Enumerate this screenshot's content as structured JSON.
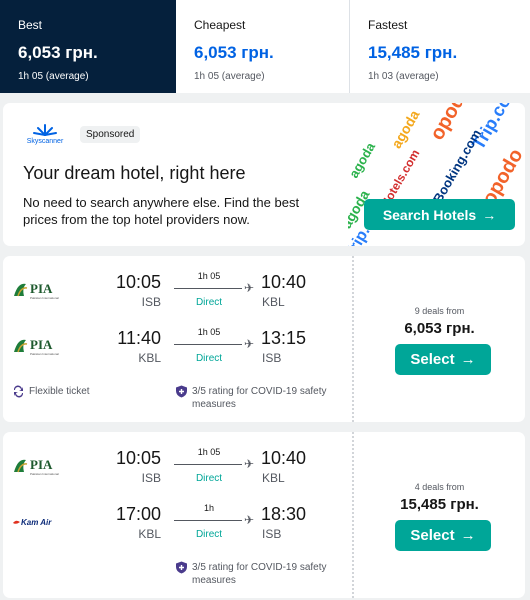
{
  "sort_tabs": [
    {
      "label": "Best",
      "price": "6,053 грн.",
      "duration": "1h 05 (average)"
    },
    {
      "label": "Cheapest",
      "price": "6,053 грн.",
      "duration": "1h 05 (average)"
    },
    {
      "label": "Fastest",
      "price": "15,485 грн.",
      "duration": "1h 03 (average)"
    }
  ],
  "ad": {
    "brand": "Skyscanner",
    "sponsored": "Sponsored",
    "title": "Your dream hotel, right here",
    "text": "No need to search anywhere else. Find the best prices from the top hotel providers now.",
    "cta": "Search Hotels",
    "partner_logos": [
      "agoda",
      "opodo",
      "Trip.com",
      "Hotels.com",
      "Booking.com"
    ]
  },
  "results": [
    {
      "legs": [
        {
          "airline": "PIA",
          "airline_sub": "Pakistan International",
          "dep_time": "10:05",
          "dep_code": "ISB",
          "duration": "1h 05",
          "stops": "Direct",
          "arr_time": "10:40",
          "arr_code": "KBL"
        },
        {
          "airline": "PIA",
          "airline_sub": "Pakistan International",
          "dep_time": "11:40",
          "dep_code": "KBL",
          "duration": "1h 05",
          "stops": "Direct",
          "arr_time": "13:15",
          "arr_code": "ISB"
        }
      ],
      "features": {
        "flexible": "Flexible ticket",
        "covid": "3/5 rating for COVID-19 safety measures"
      },
      "deals": "9 deals from",
      "price": "6,053 грн.",
      "select": "Select"
    },
    {
      "legs": [
        {
          "airline": "PIA",
          "airline_sub": "Pakistan International",
          "dep_time": "10:05",
          "dep_code": "ISB",
          "duration": "1h 05",
          "stops": "Direct",
          "arr_time": "10:40",
          "arr_code": "KBL"
        },
        {
          "airline": "Kam Air",
          "dep_time": "17:00",
          "dep_code": "KBL",
          "duration": "1h",
          "stops": "Direct",
          "arr_time": "18:30",
          "arr_code": "ISB"
        }
      ],
      "features": {
        "covid": "3/5 rating for COVID-19 safety measures"
      },
      "deals": "4 deals from",
      "price": "15,485 грн.",
      "select": "Select"
    }
  ],
  "colors": {
    "primary": "#05203c",
    "accent": "#00a698",
    "price_blue": "#0062e3"
  }
}
